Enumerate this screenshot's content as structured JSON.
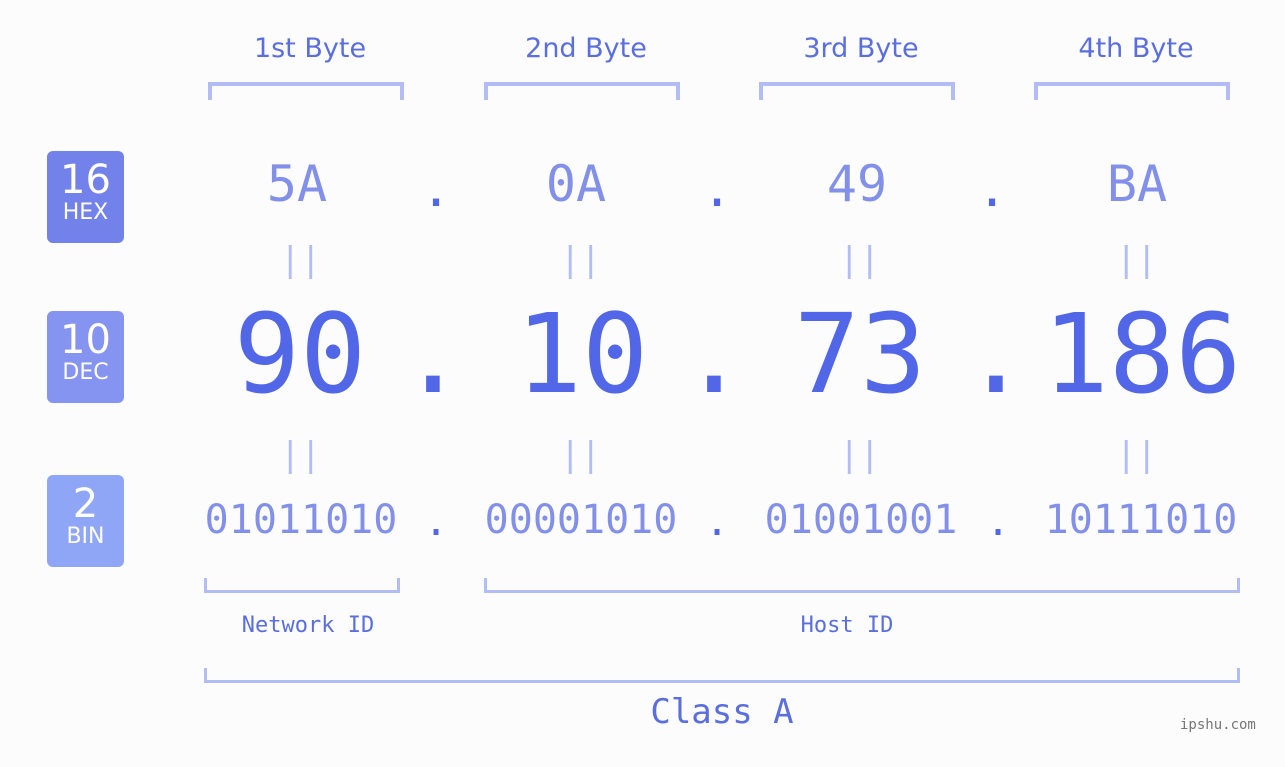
{
  "bytes": [
    {
      "label": "1st Byte",
      "hex": "5A",
      "dec": "90",
      "bin": "01011010"
    },
    {
      "label": "2nd Byte",
      "hex": "0A",
      "dec": "10",
      "bin": "00001010"
    },
    {
      "label": "3rd Byte",
      "hex": "49",
      "dec": "73",
      "bin": "01001001"
    },
    {
      "label": "4th Byte",
      "hex": "BA",
      "dec": "186",
      "bin": "10111010"
    }
  ],
  "badges": {
    "hex": {
      "num": "16",
      "text": "HEX",
      "color": "#7282ea"
    },
    "dec": {
      "num": "10",
      "text": "DEC",
      "color": "#8594f0"
    },
    "bin": {
      "num": "2",
      "text": "BIN",
      "color": "#8fa6f6"
    }
  },
  "separator": ".",
  "equals": "||",
  "network_id": "Network ID",
  "host_id": "Host ID",
  "class_label": "Class A",
  "watermark": "ipshu.com"
}
